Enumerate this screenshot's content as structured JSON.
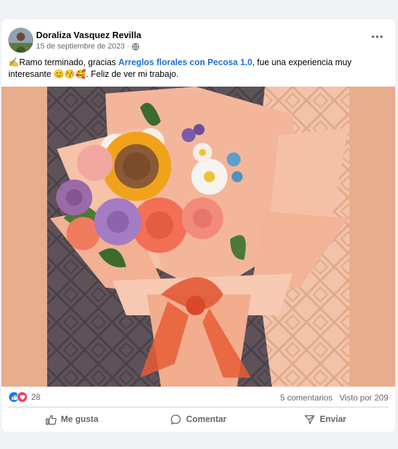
{
  "post": {
    "author": "Doraliza Vasquez Revilla",
    "date": "15 de septiembre de 2023",
    "date_separator": "·",
    "text_prefix": "✍️Ramo terminado, gracias ",
    "text_link": "Arreglos florales con Pecosa 1.0",
    "text_middle": ", fue una experiencia muy interesante ",
    "text_emojis": "😊😚🥰",
    "text_suffix": ". Feliz de ver mi trabajo."
  },
  "reactions": {
    "count": "28",
    "comments": "5 comentarios",
    "views": "Visto por 209",
    "like_color": "#1877f2",
    "love_color": "#f33e58"
  },
  "actions": {
    "like": "Me gusta",
    "comment": "Comentar",
    "share": "Enviar"
  },
  "icons": [
    "globe-icon",
    "more-options-icon",
    "like-reaction-icon",
    "love-reaction-icon",
    "thumbs-up-icon",
    "comment-bubble-icon",
    "send-icon"
  ]
}
